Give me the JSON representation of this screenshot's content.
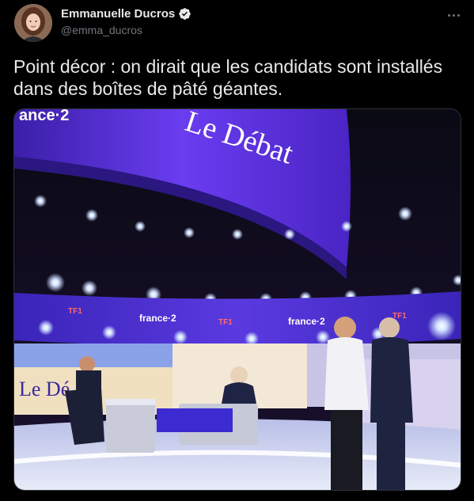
{
  "tweet": {
    "author_name": "Emmanuelle Ducros",
    "author_handle": "@emma_ducros",
    "verified": true,
    "text": "Point décor : on dirait que les candidats sont installés dans des boîtes de pâté géantes."
  },
  "icons": {
    "avatar": "author-avatar",
    "verified": "verified-badge-icon",
    "more": "more-options-icon"
  },
  "media": {
    "top_logo": "ance·2",
    "banner": "Le Débat",
    "ring_label_1": "france·2",
    "ring_label_2": "france·2",
    "ring_tf1_1": "TF1",
    "ring_tf1_2": "TF1",
    "ring_tf1_3": "TF1",
    "screen_text": "Le Dé"
  },
  "colors": {
    "background": "#000000",
    "text": "#e7e9ea",
    "muted": "#71767b",
    "verified": "#e7e9ea",
    "stage_purple": "#5b2bd6"
  }
}
